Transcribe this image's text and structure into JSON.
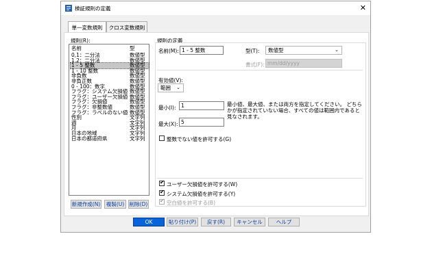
{
  "window": {
    "title": "検証規則の定義",
    "close_glyph": "✕"
  },
  "tabs": [
    "単一変数規則",
    "クロス変数規則"
  ],
  "rule_list": {
    "label": "規則(R):",
    "columns": [
      "名前",
      "型"
    ],
    "rows": [
      [
        "0,1：二分法",
        "数値型"
      ],
      [
        "1,2：二分法",
        "数値型"
      ],
      [
        "1 - 5 整数",
        "数値型"
      ],
      [
        "1 - 10 整数",
        "数値型"
      ],
      [
        "非負数",
        "数値型"
      ],
      [
        "非負正数",
        "数値型"
      ],
      [
        "0 - 100：数字",
        "数値型"
      ],
      [
        "フラグ：システム欠損値",
        "数値型"
      ],
      [
        "フラグ：ユーザー欠損値",
        "数値型"
      ],
      [
        "フラグ：欠損値",
        "数値型"
      ],
      [
        "フラグ：非整数値",
        "数値型"
      ],
      [
        "フラグ：ラベルのない値",
        "数値型"
      ],
      [
        "性別",
        "文字列"
      ],
      [
        "週",
        "文字列"
      ],
      [
        "月",
        "文字列"
      ],
      [
        "日本の地域",
        "文字列"
      ],
      [
        "日本の都道府県",
        "文字列"
      ]
    ],
    "selected_index": 2,
    "buttons": [
      "新規作成(N)",
      "複製(U)",
      "削除(D)"
    ]
  },
  "definition": {
    "group_label": "規則の定義",
    "name_label": "名前(M):",
    "name_value": "1 - 5 整数",
    "type_label": "型(T):",
    "type_value": "数値型",
    "format_label": "書式(F):",
    "format_placeholder": "mm/dd/yyyy",
    "valid_values_label": "有効値(V):",
    "valid_values_option": "範囲",
    "min_label": "最小(I):",
    "min_value": "1",
    "max_label": "最大(X):",
    "max_value": "5",
    "range_description": "最小値、最大値、または両方を指定してください。 どちらかが指定されていない場合、すべての値は範囲内であると見なされます。",
    "non_integer_checkbox": {
      "label": "整数でない値を許可する(G)",
      "checked": false
    },
    "allow_checkboxes": [
      {
        "label": "ユーザー欠損値を許可する(W)",
        "checked": true
      },
      {
        "label": "システム欠損値を許可する(Y)",
        "checked": true
      },
      {
        "label": "空白値を許可する(B)",
        "checked": true,
        "disabled": true
      }
    ]
  },
  "footer_buttons": [
    "OK",
    "貼り付け(P)",
    "戻す(R)",
    "キャンセル",
    "ヘルプ"
  ],
  "colors": {
    "accent": "#0a64d9",
    "selection": "#c7c7c7"
  }
}
